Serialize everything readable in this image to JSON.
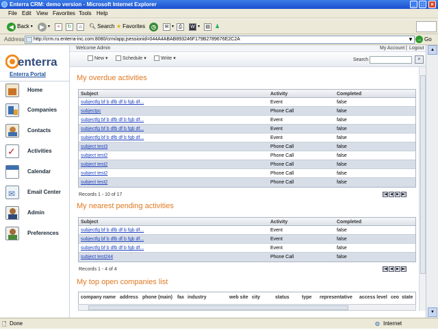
{
  "window": {
    "title": "Enterra CRM: demo version - Microsoft Internet Explorer"
  },
  "menu": [
    "File",
    "Edit",
    "View",
    "Favorites",
    "Tools",
    "Help"
  ],
  "toolbar": {
    "back": "Back",
    "search": "Search",
    "favorites": "Favorites"
  },
  "address": {
    "label": "Address",
    "url": "http://crm.ru.enterra-inc.com:8080/crm/app;jsessionid=044A4ABAB893246F179B2789676E2C2A",
    "go": "Go"
  },
  "sidebar": {
    "logo": "enterra",
    "portal_link": "Enterra Portal",
    "items": [
      {
        "label": "Home"
      },
      {
        "label": "Companies"
      },
      {
        "label": "Contacts"
      },
      {
        "label": "Activities"
      },
      {
        "label": "Calendar"
      },
      {
        "label": "Email Center"
      },
      {
        "label": "Admin"
      },
      {
        "label": "Preferences"
      }
    ]
  },
  "header": {
    "welcome": "Welcome Admin",
    "my_account": "My Account",
    "sep": "|",
    "logout": "Logout"
  },
  "app_toolbar": {
    "new": "New",
    "schedule": "Schedule",
    "write": "Write",
    "search_label": "Search"
  },
  "overdue": {
    "title": "My overdue activities",
    "columns": [
      "Subject",
      "Activity",
      "Completed"
    ],
    "rows": [
      [
        "subjectfg bf b dfb df b fgb df...",
        "Event",
        "false"
      ],
      [
        "subjectpc",
        "Phone Call",
        "false"
      ],
      [
        "subjectfg bf b dfb df b fgb df...",
        "Event",
        "false"
      ],
      [
        "subjectfg bf b dfb df b fgb df...",
        "Event",
        "false"
      ],
      [
        "subjectfg bf b dfb df b fgb df...",
        "Event",
        "false"
      ],
      [
        "subject test3",
        "Phone Call",
        "false"
      ],
      [
        "subject test2",
        "Phone Call",
        "false"
      ],
      [
        "subject test2",
        "Phone Call",
        "false"
      ],
      [
        "subject test2",
        "Phone Call",
        "false"
      ],
      [
        "subject test2",
        "Phone Call",
        "false"
      ]
    ],
    "records": "Records 1 - 10 of 17"
  },
  "pending": {
    "title": "My nearest pending activities",
    "columns": [
      "Subject",
      "Activity",
      "Completed"
    ],
    "rows": [
      [
        "subjectfg bf b dfb df b fgb df...",
        "Event",
        "false"
      ],
      [
        "subjectfg bf b dfb df b fgb df...",
        "Event",
        "false"
      ],
      [
        "subjectfg bf b dfb df b fgb df...",
        "Event",
        "false"
      ],
      [
        "subject test244",
        "Phone Call",
        "false"
      ]
    ],
    "records": "Records 1 - 4 of 4"
  },
  "companies": {
    "title": "My top open companies list",
    "columns": [
      "company name",
      "address",
      "phone (main)",
      "fax",
      "industry",
      "web site",
      "city",
      "status",
      "type",
      "representative",
      "access level",
      "ceo",
      "state"
    ]
  },
  "statusbar": {
    "left": "Done",
    "right": "Internet"
  },
  "colors": {
    "accent": "#e07820",
    "link": "#1a3fbf",
    "row_alt": "#d8dee8"
  }
}
